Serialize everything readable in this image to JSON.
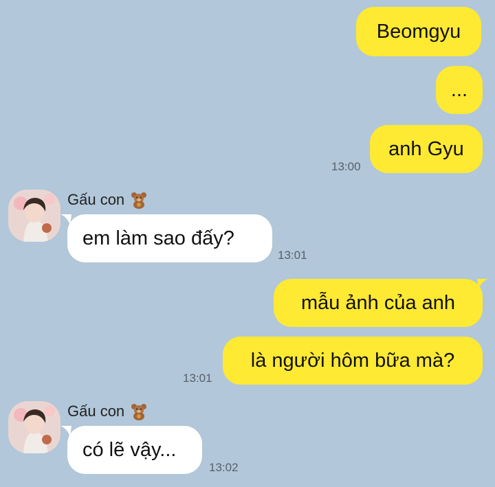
{
  "messages_out_1": {
    "b1": "Beomgyu",
    "b2": "...",
    "b3": "anh Gyu",
    "time": "13:00"
  },
  "contact": {
    "name": "Gấu con",
    "emoji_icon": "teddy-bear-icon"
  },
  "messages_in_1": {
    "b1": "em làm sao đấy?",
    "time": "13:01"
  },
  "messages_out_2": {
    "b1": "mẫu ảnh của anh",
    "b2": "là người hôm bữa mà?",
    "time": "13:01"
  },
  "messages_in_2": {
    "b1": "có lẽ vậy...",
    "time": "13:02"
  },
  "colors": {
    "background": "#b2c7d9",
    "outgoing": "#fee933",
    "incoming": "#ffffff"
  }
}
